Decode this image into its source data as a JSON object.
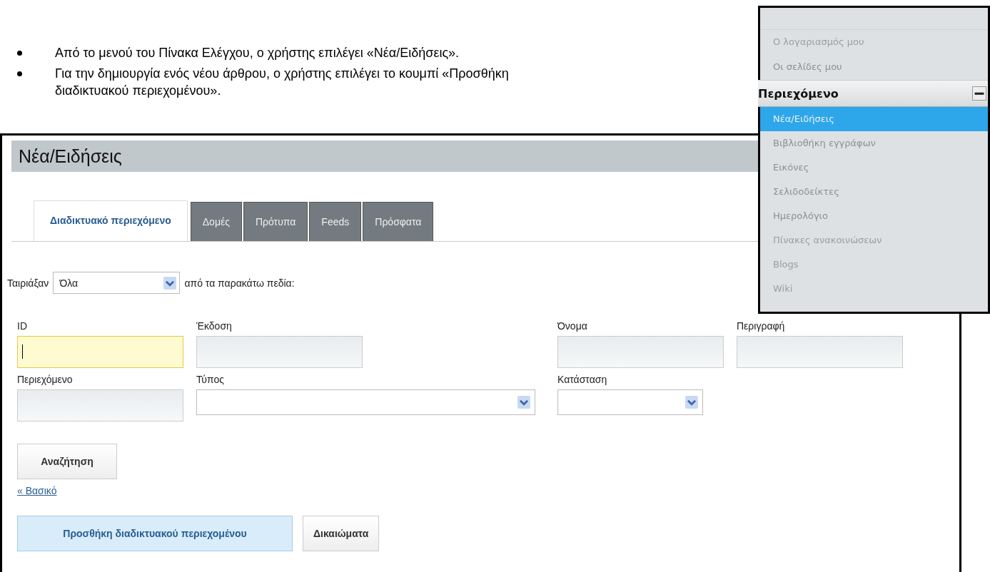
{
  "bullets": [
    "Από το μενού του Πίνακα Ελέγχου, ο χρήστης επιλέγει «Νέα/Ειδήσεις».",
    "Για την δημιουργία ενός νέου άρθρου, ο χρήστης επιλέγει το κουμπί «Προσθήκη διαδικτυακού περιεχομένου»."
  ],
  "portlet": {
    "title": "Νέα/Ειδήσεις",
    "tabs": [
      {
        "label": "Διαδικτυακό περιεχόμενο",
        "selected": true
      },
      {
        "label": "Δομές",
        "selected": false
      },
      {
        "label": "Πρότυπα",
        "selected": false
      },
      {
        "label": "Feeds",
        "selected": false
      },
      {
        "label": "Πρόσφατα",
        "selected": false
      }
    ],
    "match": {
      "label": "Ταιριάξαν",
      "value": "Όλα",
      "suffix": "από τα παρακάτω πεδία:"
    },
    "fields": [
      {
        "label": "ID",
        "kind": "text",
        "focused": true
      },
      {
        "label": "Έκδοση",
        "kind": "text",
        "focused": false
      },
      {
        "label": "Όνομα",
        "kind": "text",
        "focused": false
      },
      {
        "label": "Περιγραφή",
        "kind": "text",
        "focused": false
      },
      {
        "label": "Περιεχόμενο",
        "kind": "text",
        "focused": false
      },
      {
        "label": "Τύπος",
        "kind": "select",
        "focused": false
      },
      {
        "label": "Κατάσταση",
        "kind": "select",
        "focused": false
      }
    ],
    "search_button": "Αναζήτηση",
    "basic_link": "« Βασικό",
    "actions": [
      {
        "label": "Προσθήκη διαδικτυακού περιεχομένου",
        "highlighted": true
      },
      {
        "label": "Δικαιώματα",
        "highlighted": false
      }
    ]
  },
  "menu": {
    "items_top": [
      {
        "label": "Ο λογαριασμός μου",
        "faded": true
      },
      {
        "label": "Οι σελίδες μου",
        "faded": false
      }
    ],
    "section": {
      "title": "Περιεχόμενο",
      "expanded": true
    },
    "items": [
      {
        "label": "Νέα/Ειδήσεις",
        "selected": true,
        "faded": false
      },
      {
        "label": "Βιβλιοθήκη εγγράφων",
        "selected": false,
        "faded": false
      },
      {
        "label": "Εικόνες",
        "selected": false,
        "faded": false
      },
      {
        "label": "Σελιδοδείκτες",
        "selected": false,
        "faded": false
      },
      {
        "label": "Ημερολόγιο",
        "selected": false,
        "faded": false
      },
      {
        "label": "Πίνακες ανακοινώσεων",
        "selected": false,
        "faded": true
      },
      {
        "label": "Blogs",
        "selected": false,
        "faded": true
      },
      {
        "label": "Wiki",
        "selected": false,
        "faded": true
      }
    ]
  }
}
